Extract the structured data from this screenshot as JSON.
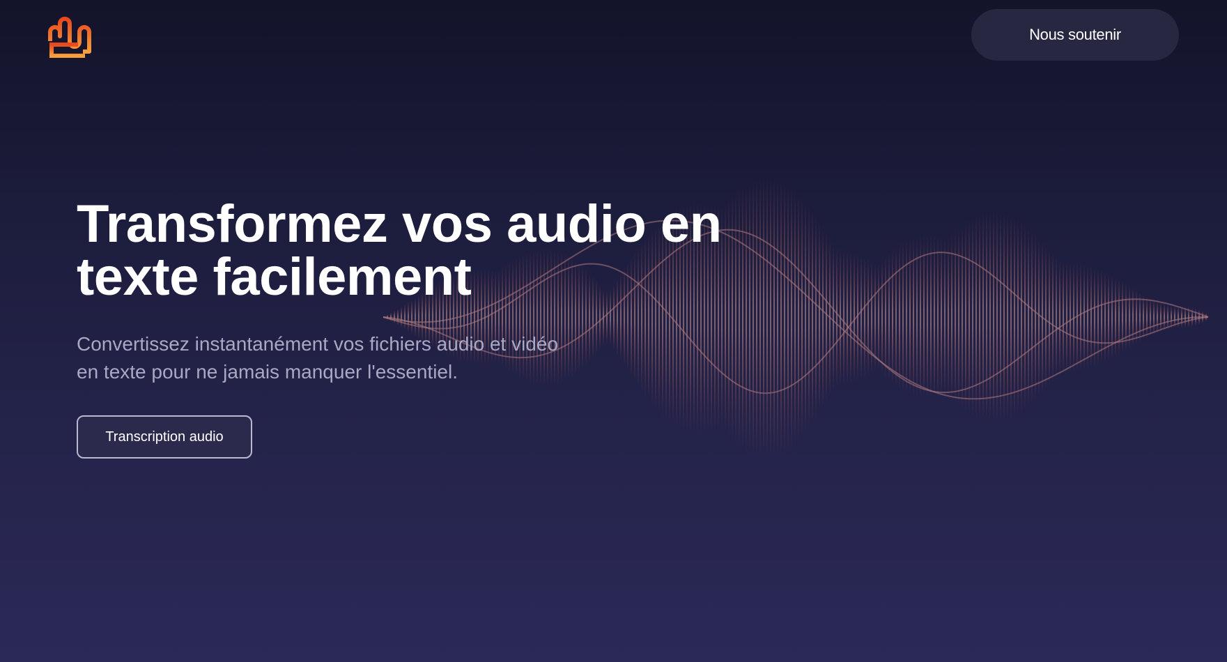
{
  "header": {
    "logo_icon": "waveform-hand-logo",
    "support_label": "Nous soutenir"
  },
  "hero": {
    "title_line1": "Transformez vos audio en",
    "title_line2": "texte facilement",
    "subtitle_line1": "Convertissez instantanément vos fichiers audio et vidéo",
    "subtitle_line2": "en texte pour ne jamais manquer l'essentiel.",
    "cta_label": "Transcription audio"
  },
  "colors": {
    "accent_orange": "#f26a2a",
    "accent_gold": "#f7a03a",
    "wave": "#c0706a",
    "background_top": "#13132a",
    "background_bottom": "#2b2957"
  }
}
